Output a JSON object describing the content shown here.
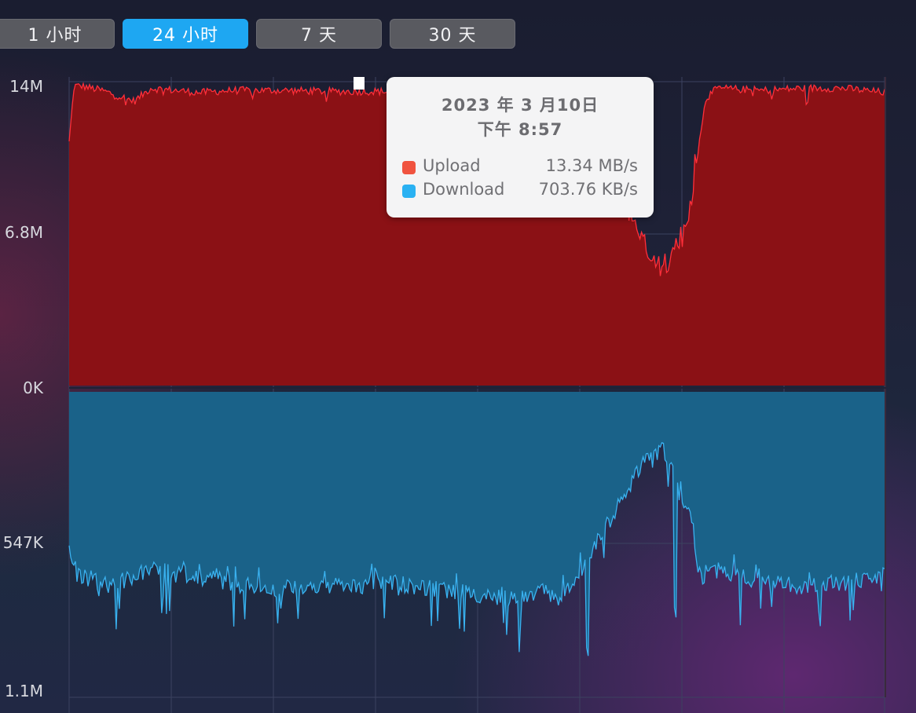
{
  "tabs": [
    {
      "label": "1 小时",
      "active": false
    },
    {
      "label": "24 小时",
      "active": true
    },
    {
      "label": "7 天",
      "active": false
    },
    {
      "label": "30 天",
      "active": false
    }
  ],
  "colors": {
    "upload_fill": "#8b1115",
    "upload_line": "#ff2f3a",
    "download_fill": "#1a6289",
    "download_line": "#3ab2f0",
    "tab_active": "#1ea7f2",
    "tooltip_upload_swatch": "#f0533f",
    "tooltip_download_swatch": "#2ab1f2"
  },
  "tooltip": {
    "date": "2023 年 3 月10日",
    "time": "下午 8:57",
    "rows": [
      {
        "name": "Upload",
        "value": "13.34 MB/s"
      },
      {
        "name": "Download",
        "value": "703.76 KB/s"
      }
    ]
  },
  "chart_data": {
    "type": "area",
    "panels": [
      {
        "series": "Upload",
        "y_tick_labels": [
          "14M",
          "6.8M",
          "0K"
        ],
        "ylim": [
          0,
          14
        ],
        "unit": "MB/s",
        "orientation": "up",
        "baseline_points": [
          [
            0.0,
            11.2
          ],
          [
            0.006,
            13.8
          ],
          [
            0.015,
            13.8
          ],
          [
            0.04,
            13.6
          ],
          [
            0.08,
            13.1
          ],
          [
            0.1,
            13.7
          ],
          [
            0.16,
            13.5
          ],
          [
            0.2,
            13.6
          ],
          [
            0.26,
            13.6
          ],
          [
            0.33,
            13.55
          ],
          [
            0.4,
            13.55
          ],
          [
            0.56,
            13.55
          ],
          [
            0.6,
            13.5
          ],
          [
            0.64,
            13.2
          ],
          [
            0.665,
            11.8
          ],
          [
            0.69,
            7.6
          ],
          [
            0.705,
            6.7
          ],
          [
            0.715,
            6.0
          ],
          [
            0.725,
            5.6
          ],
          [
            0.737,
            5.4
          ],
          [
            0.742,
            6.5
          ],
          [
            0.752,
            6.8
          ],
          [
            0.76,
            7.5
          ],
          [
            0.768,
            10.4
          ],
          [
            0.774,
            11.8
          ],
          [
            0.78,
            13.2
          ],
          [
            0.795,
            13.7
          ],
          [
            0.85,
            13.6
          ],
          [
            0.9,
            13.7
          ],
          [
            0.95,
            13.7
          ],
          [
            1.0,
            13.5
          ]
        ]
      },
      {
        "series": "Download",
        "y_tick_labels": [
          "547K",
          "1.1M"
        ],
        "ylim": [
          0,
          1100
        ],
        "unit": "KB/s",
        "orientation": "down",
        "baseline_points": [
          [
            0.0,
            550
          ],
          [
            0.01,
            660
          ],
          [
            0.05,
            700
          ],
          [
            0.1,
            640
          ],
          [
            0.15,
            660
          ],
          [
            0.2,
            690
          ],
          [
            0.25,
            710
          ],
          [
            0.3,
            700
          ],
          [
            0.35,
            700
          ],
          [
            0.4,
            690
          ],
          [
            0.45,
            710
          ],
          [
            0.5,
            730
          ],
          [
            0.55,
            750
          ],
          [
            0.58,
            720
          ],
          [
            0.6,
            740
          ],
          [
            0.63,
            640
          ],
          [
            0.65,
            520
          ],
          [
            0.67,
            430
          ],
          [
            0.69,
            330
          ],
          [
            0.705,
            230
          ],
          [
            0.715,
            250
          ],
          [
            0.727,
            200
          ],
          [
            0.738,
            260
          ],
          [
            0.748,
            370
          ],
          [
            0.76,
            420
          ],
          [
            0.766,
            500
          ],
          [
            0.77,
            630
          ],
          [
            0.775,
            680
          ],
          [
            0.79,
            650
          ],
          [
            0.85,
            680
          ],
          [
            0.9,
            700
          ],
          [
            0.95,
            690
          ],
          [
            1.0,
            660
          ]
        ]
      }
    ]
  }
}
